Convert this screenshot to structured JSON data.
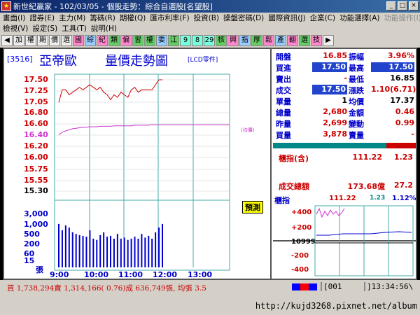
{
  "window": {
    "title": "新世紀贏家 - 102/03/05 - 個股走勢：綜合自選股[名望股]",
    "btn_min": "_",
    "btn_max": "□",
    "btn_close": "×"
  },
  "menu": {
    "row1": [
      "畫面(I)",
      "證券(E)",
      "主力(M)",
      "籌碼(R)",
      "期權(Q)",
      "匯市利率(F)",
      "投資(B)",
      "操盤密碼(D)",
      "國際資訊(J)",
      "企業(C)",
      "功能選擇(A)",
      "功能操作(I)"
    ],
    "row2": [
      "檢視(V)",
      "設定(S)",
      "工具(T)",
      "說明(H)"
    ]
  },
  "toolbar": [
    "◀",
    "加",
    "權",
    "期",
    "價",
    "選",
    "國",
    "綜",
    "紀",
    "類",
    "偏",
    "習",
    "權",
    "委",
    "江",
    "9",
    "8",
    "29",
    "核",
    "興",
    "指",
    "厚",
    "鬆",
    "產",
    "翻",
    "選",
    "技",
    "▶"
  ],
  "stock": {
    "code": "[3516]",
    "name": "亞帝歐",
    "chart_title": "量價走勢圖",
    "lcd": "[LCD零件]",
    "estimate": "預測",
    "avg_tag": "(均價)"
  },
  "price_axis": [
    "17.50",
    "17.25",
    "17.05",
    "16.80",
    "16.60",
    "16.40",
    "16.20",
    "16.00",
    "15.75",
    "15.55",
    "15.30"
  ],
  "volume_axis": [
    "3,000",
    "1,000",
    "500",
    "200",
    "60",
    "15",
    "張"
  ],
  "time_axis": [
    "9:00",
    "10:00",
    "11:00",
    "12:00",
    "13:00"
  ],
  "chart_data": {
    "type": "line",
    "title": "量價走勢圖",
    "x": [
      "9:00",
      "9:05",
      "9:10",
      "9:15",
      "9:20",
      "9:25",
      "9:30",
      "9:35",
      "9:40",
      "9:45",
      "9:50",
      "9:55",
      "10:00",
      "10:05",
      "10:10",
      "10:15",
      "10:20",
      "10:25",
      "10:30",
      "10:35",
      "10:40",
      "10:45",
      "10:50",
      "10:55",
      "11:00",
      "11:05",
      "11:10",
      "11:15",
      "11:20",
      "11:25",
      "11:30"
    ],
    "series": [
      {
        "values": [
          17.05,
          17.3,
          17.3,
          17.2,
          17.25,
          17.3,
          17.35,
          17.3,
          17.35,
          17.4,
          17.35,
          17.3,
          17.35,
          17.25,
          17.2,
          17.1,
          17.2,
          17.15,
          17.25,
          17.2,
          17.15,
          17.3,
          17.35,
          17.25,
          17.3,
          17.3,
          17.3,
          17.3,
          17.4,
          17.5,
          17.5
        ],
        "color": "#c00"
      },
      {
        "values": [
          16.4,
          16.45,
          16.48,
          16.5,
          16.52,
          16.53,
          16.54,
          16.55,
          16.55,
          16.56,
          16.56,
          16.56,
          16.57,
          16.57,
          16.57,
          16.57,
          16.58,
          16.58,
          16.58,
          16.58,
          16.58,
          16.58,
          16.59,
          16.59,
          16.59,
          16.59,
          16.59,
          16.6,
          16.6,
          16.6,
          16.6
        ],
        "color": "#c3c"
      }
    ],
    "volume": [
      500,
      200,
      400,
      300,
      150,
      120,
      100,
      90,
      80,
      200,
      60,
      50,
      100,
      150,
      80,
      90,
      60,
      120,
      60,
      70,
      50,
      60,
      80,
      60,
      120,
      70,
      90,
      60,
      150,
      300,
      500
    ],
    "ylim": [
      15.3,
      17.5
    ],
    "colors": {
      "price": "#c00",
      "avg": "#c3c",
      "volume": "#00c",
      "grid": "#4aa"
    }
  },
  "quote": {
    "rows": [
      {
        "l1": "開盤",
        "v1": "16.85",
        "l2": "振幅",
        "v2": "3.96%"
      },
      {
        "l1": "買進",
        "v1": "17.50",
        "l2": "最高",
        "v2": "17.50"
      },
      {
        "l1": "賣出",
        "v1": "-",
        "l2": "最低",
        "v2": "16.85"
      },
      {
        "l1": "成交",
        "v1": "17.50",
        "l2": "漲跌",
        "v2": "1.10(6.71)"
      },
      {
        "l1": "單量",
        "v1": "1",
        "l2": "均價",
        "v2": "17.37"
      },
      {
        "l1": "總量",
        "v1": "2,680",
        "l2": "金額",
        "v2": "0.46"
      },
      {
        "l1": "昨量",
        "v1": "2,699",
        "l2": "變動",
        "v2": "0.99"
      },
      {
        "l1": "買量",
        "v1": "3,878",
        "l2": "賣量",
        "v2": "-"
      }
    ]
  },
  "index": {
    "label": "櫃指(含)",
    "value": "111.22",
    "change": "1.23",
    "total_label": "成交總額",
    "total_value": "173.68億",
    "total_change": "27.2"
  },
  "mini": {
    "title": "櫃指",
    "v1": "111.22",
    "v2": "1.23",
    "v3": "1.12%",
    "axis": [
      "+400",
      "+200",
      "10999",
      "-200",
      "-400"
    ]
  },
  "status": {
    "text": "買 1,738,294賣 1,314,166( 0.76)成 636,749張, 均張 3.5",
    "code": "[001",
    "time": "]13:34:56\\"
  },
  "url": "http://kujd3268.pixnet.net/album"
}
